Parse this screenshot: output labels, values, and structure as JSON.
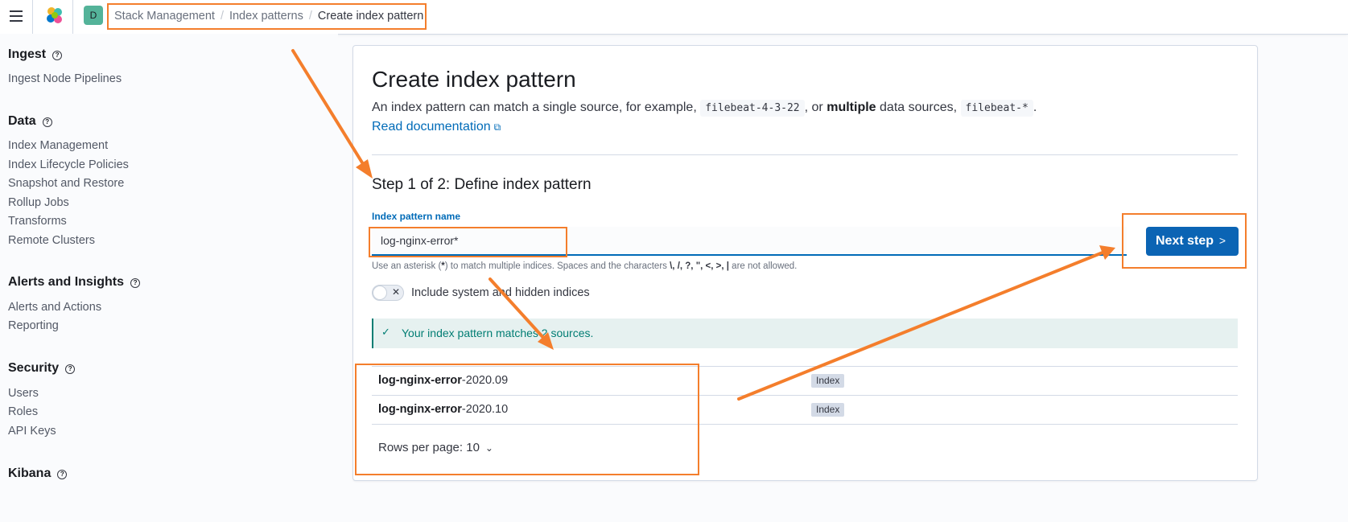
{
  "header": {
    "menu_icon": "hamburger-menu-icon",
    "logo_icon": "elastic-logo-icon",
    "space_avatar": "D",
    "breadcrumbs": [
      "Stack Management",
      "Index patterns",
      "Create index pattern"
    ]
  },
  "sidebar": {
    "sections": [
      {
        "title": "Ingest",
        "items": [
          "Ingest Node Pipelines"
        ]
      },
      {
        "title": "Data",
        "items": [
          "Index Management",
          "Index Lifecycle Policies",
          "Snapshot and Restore",
          "Rollup Jobs",
          "Transforms",
          "Remote Clusters"
        ]
      },
      {
        "title": "Alerts and Insights",
        "items": [
          "Alerts and Actions",
          "Reporting"
        ]
      },
      {
        "title": "Security",
        "items": [
          "Users",
          "Roles",
          "API Keys"
        ]
      },
      {
        "title": "Kibana",
        "items": []
      }
    ]
  },
  "main": {
    "title": "Create index pattern",
    "desc_prefix": "An index pattern can match a single source, for example,",
    "example_single": "filebeat-4-3-22",
    "desc_or": ", or",
    "desc_multiple": "multiple",
    "desc_sources": "data sources,",
    "example_multiple": "filebeat-*",
    "desc_end": ".",
    "doc_link": "Read documentation",
    "step_title": "Step 1 of 2: Define index pattern",
    "field_label": "Index pattern name",
    "input_value": "log-nginx-error*",
    "next_button": "Next step",
    "help_text_prefix": "Use an asterisk (",
    "help_asterisk": "*",
    "help_text_mid": ") to match multiple indices. Spaces and the characters",
    "help_chars": "\\, /, ?, \", <, >, |",
    "help_text_end": "are not allowed.",
    "toggle_label": "Include system and hidden indices",
    "toggle_checked": false,
    "callout": "Your index pattern matches 2 sources.",
    "matches": [
      {
        "bold": "log-nginx-error",
        "rest": "-2020.09",
        "type": "Index"
      },
      {
        "bold": "log-nginx-error",
        "rest": "-2020.10",
        "type": "Index"
      }
    ],
    "rows_per_page": "Rows per page: 10"
  },
  "annotation_color": "#f47e2c"
}
